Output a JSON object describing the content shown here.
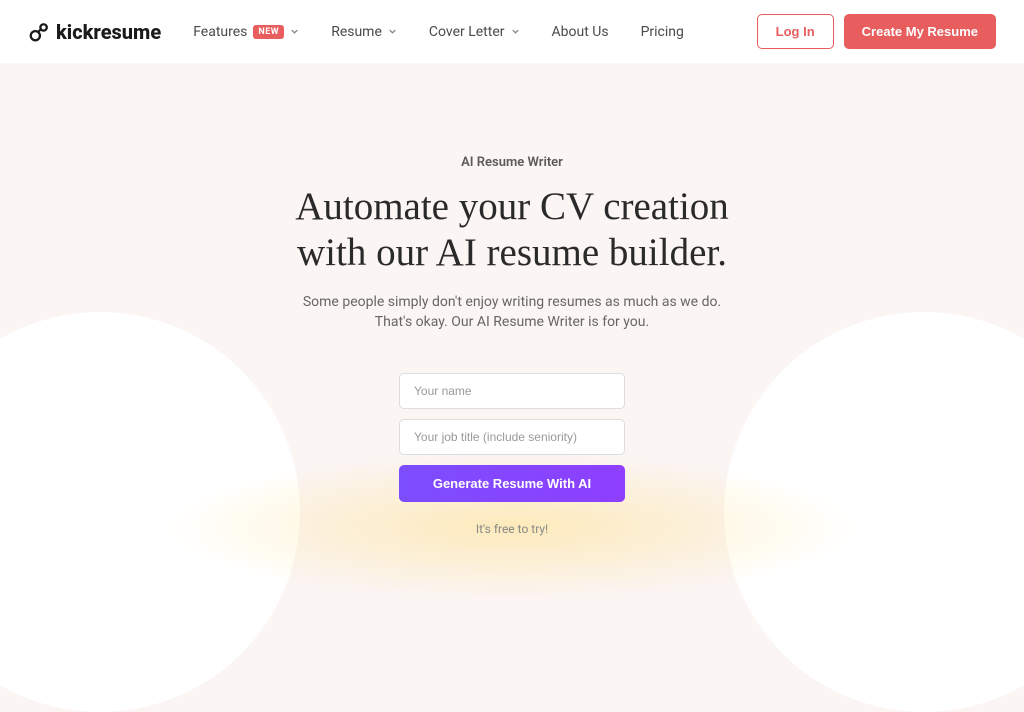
{
  "brand": {
    "name": "kickresume"
  },
  "nav": {
    "items": [
      {
        "label": "Features",
        "badge": "NEW"
      },
      {
        "label": "Resume"
      },
      {
        "label": "Cover Letter"
      },
      {
        "label": "About Us"
      },
      {
        "label": "Pricing"
      }
    ]
  },
  "header_actions": {
    "login": "Log In",
    "create": "Create My Resume"
  },
  "hero": {
    "eyebrow": "AI Resume Writer",
    "headline_line1": "Automate your CV creation",
    "headline_line2": "with our AI resume builder.",
    "subhead_line1": "Some people simply don't enjoy writing resumes as much as we do.",
    "subhead_line2": "That's okay. Our AI Resume Writer is for you."
  },
  "form": {
    "name_placeholder": "Your name",
    "job_placeholder": "Your job title (include seniority)",
    "generate_label": "Generate Resume With AI",
    "free_note": "It's free to try!"
  }
}
